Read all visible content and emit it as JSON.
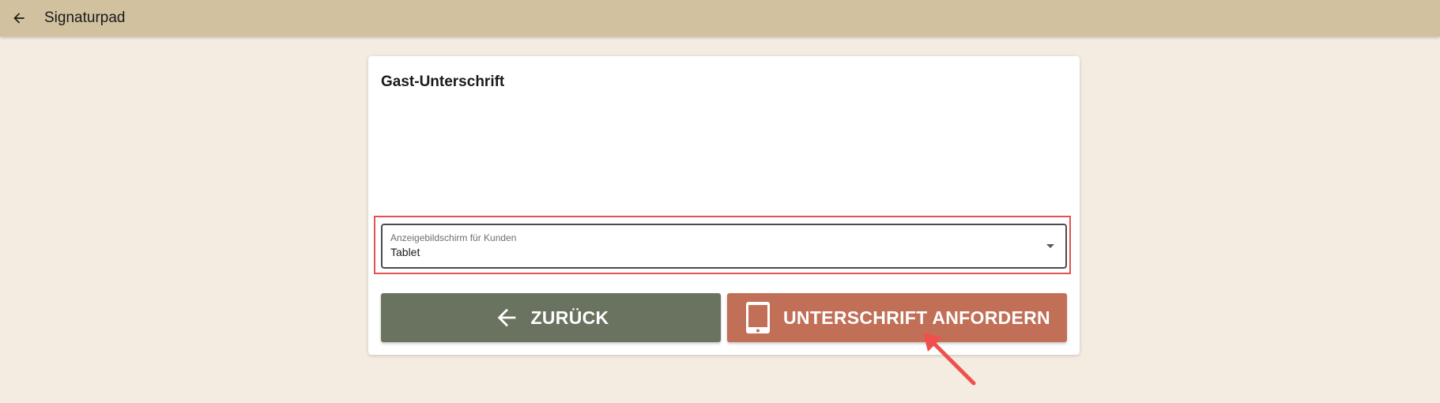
{
  "header": {
    "title": "Signaturpad",
    "back_icon": "arrow-left-icon",
    "background": "#d1c19f"
  },
  "card": {
    "title": "Gast-Unterschrift",
    "display_select": {
      "label": "Anzeigebildschirm für Kunden",
      "value": "Tablet"
    },
    "buttons": {
      "back_label": "ZURÜCK",
      "back_icon": "arrow-left-icon",
      "back_color": "#6a735f",
      "request_label": "UNTERSCHRIFT ANFORDERN",
      "request_icon": "tablet-icon",
      "request_color": "#c16f56"
    }
  },
  "annotations": {
    "highlight_color": "#e0534f",
    "arrow_color": "#f0504d"
  }
}
